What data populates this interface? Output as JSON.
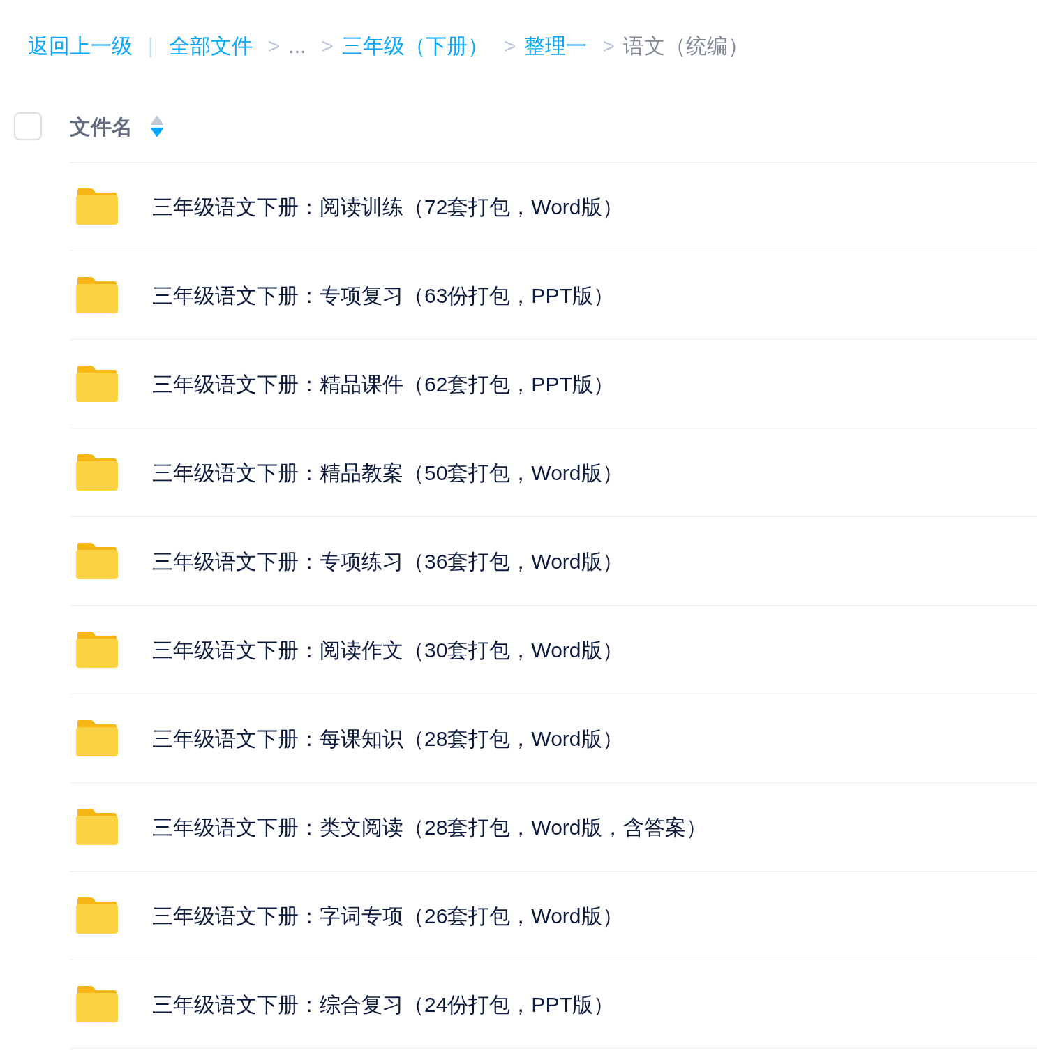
{
  "breadcrumb": [
    {
      "kind": "link",
      "label": "返回上一级"
    },
    {
      "kind": "bar",
      "label": "|"
    },
    {
      "kind": "link",
      "label": "全部文件"
    },
    {
      "kind": "chevron",
      "label": ">"
    },
    {
      "kind": "ellipsis",
      "label": "..."
    },
    {
      "kind": "chevron",
      "label": ">"
    },
    {
      "kind": "link",
      "label": "三年级（下册）"
    },
    {
      "kind": "chevron",
      "label": ">"
    },
    {
      "kind": "link",
      "label": "整理一"
    },
    {
      "kind": "chevron",
      "label": ">"
    },
    {
      "kind": "current",
      "label": "语文（统编）"
    }
  ],
  "header": {
    "checked": false,
    "column": "文件名",
    "sort_descending": true
  },
  "rows": [
    {
      "name": "三年级语文下册：阅读训练（72套打包，Word版）"
    },
    {
      "name": "三年级语文下册：专项复习（63份打包，PPT版）"
    },
    {
      "name": "三年级语文下册：精品课件（62套打包，PPT版）"
    },
    {
      "name": "三年级语文下册：精品教案（50套打包，Word版）"
    },
    {
      "name": "三年级语文下册：专项练习（36套打包，Word版）"
    },
    {
      "name": "三年级语文下册：阅读作文（30套打包，Word版）"
    },
    {
      "name": "三年级语文下册：每课知识（28套打包，Word版）"
    },
    {
      "name": "三年级语文下册：类文阅读（28套打包，Word版，含答案）"
    },
    {
      "name": "三年级语文下册：字词专项（26套打包，Word版）"
    },
    {
      "name": "三年级语文下册：综合复习（24份打包，PPT版）"
    }
  ]
}
